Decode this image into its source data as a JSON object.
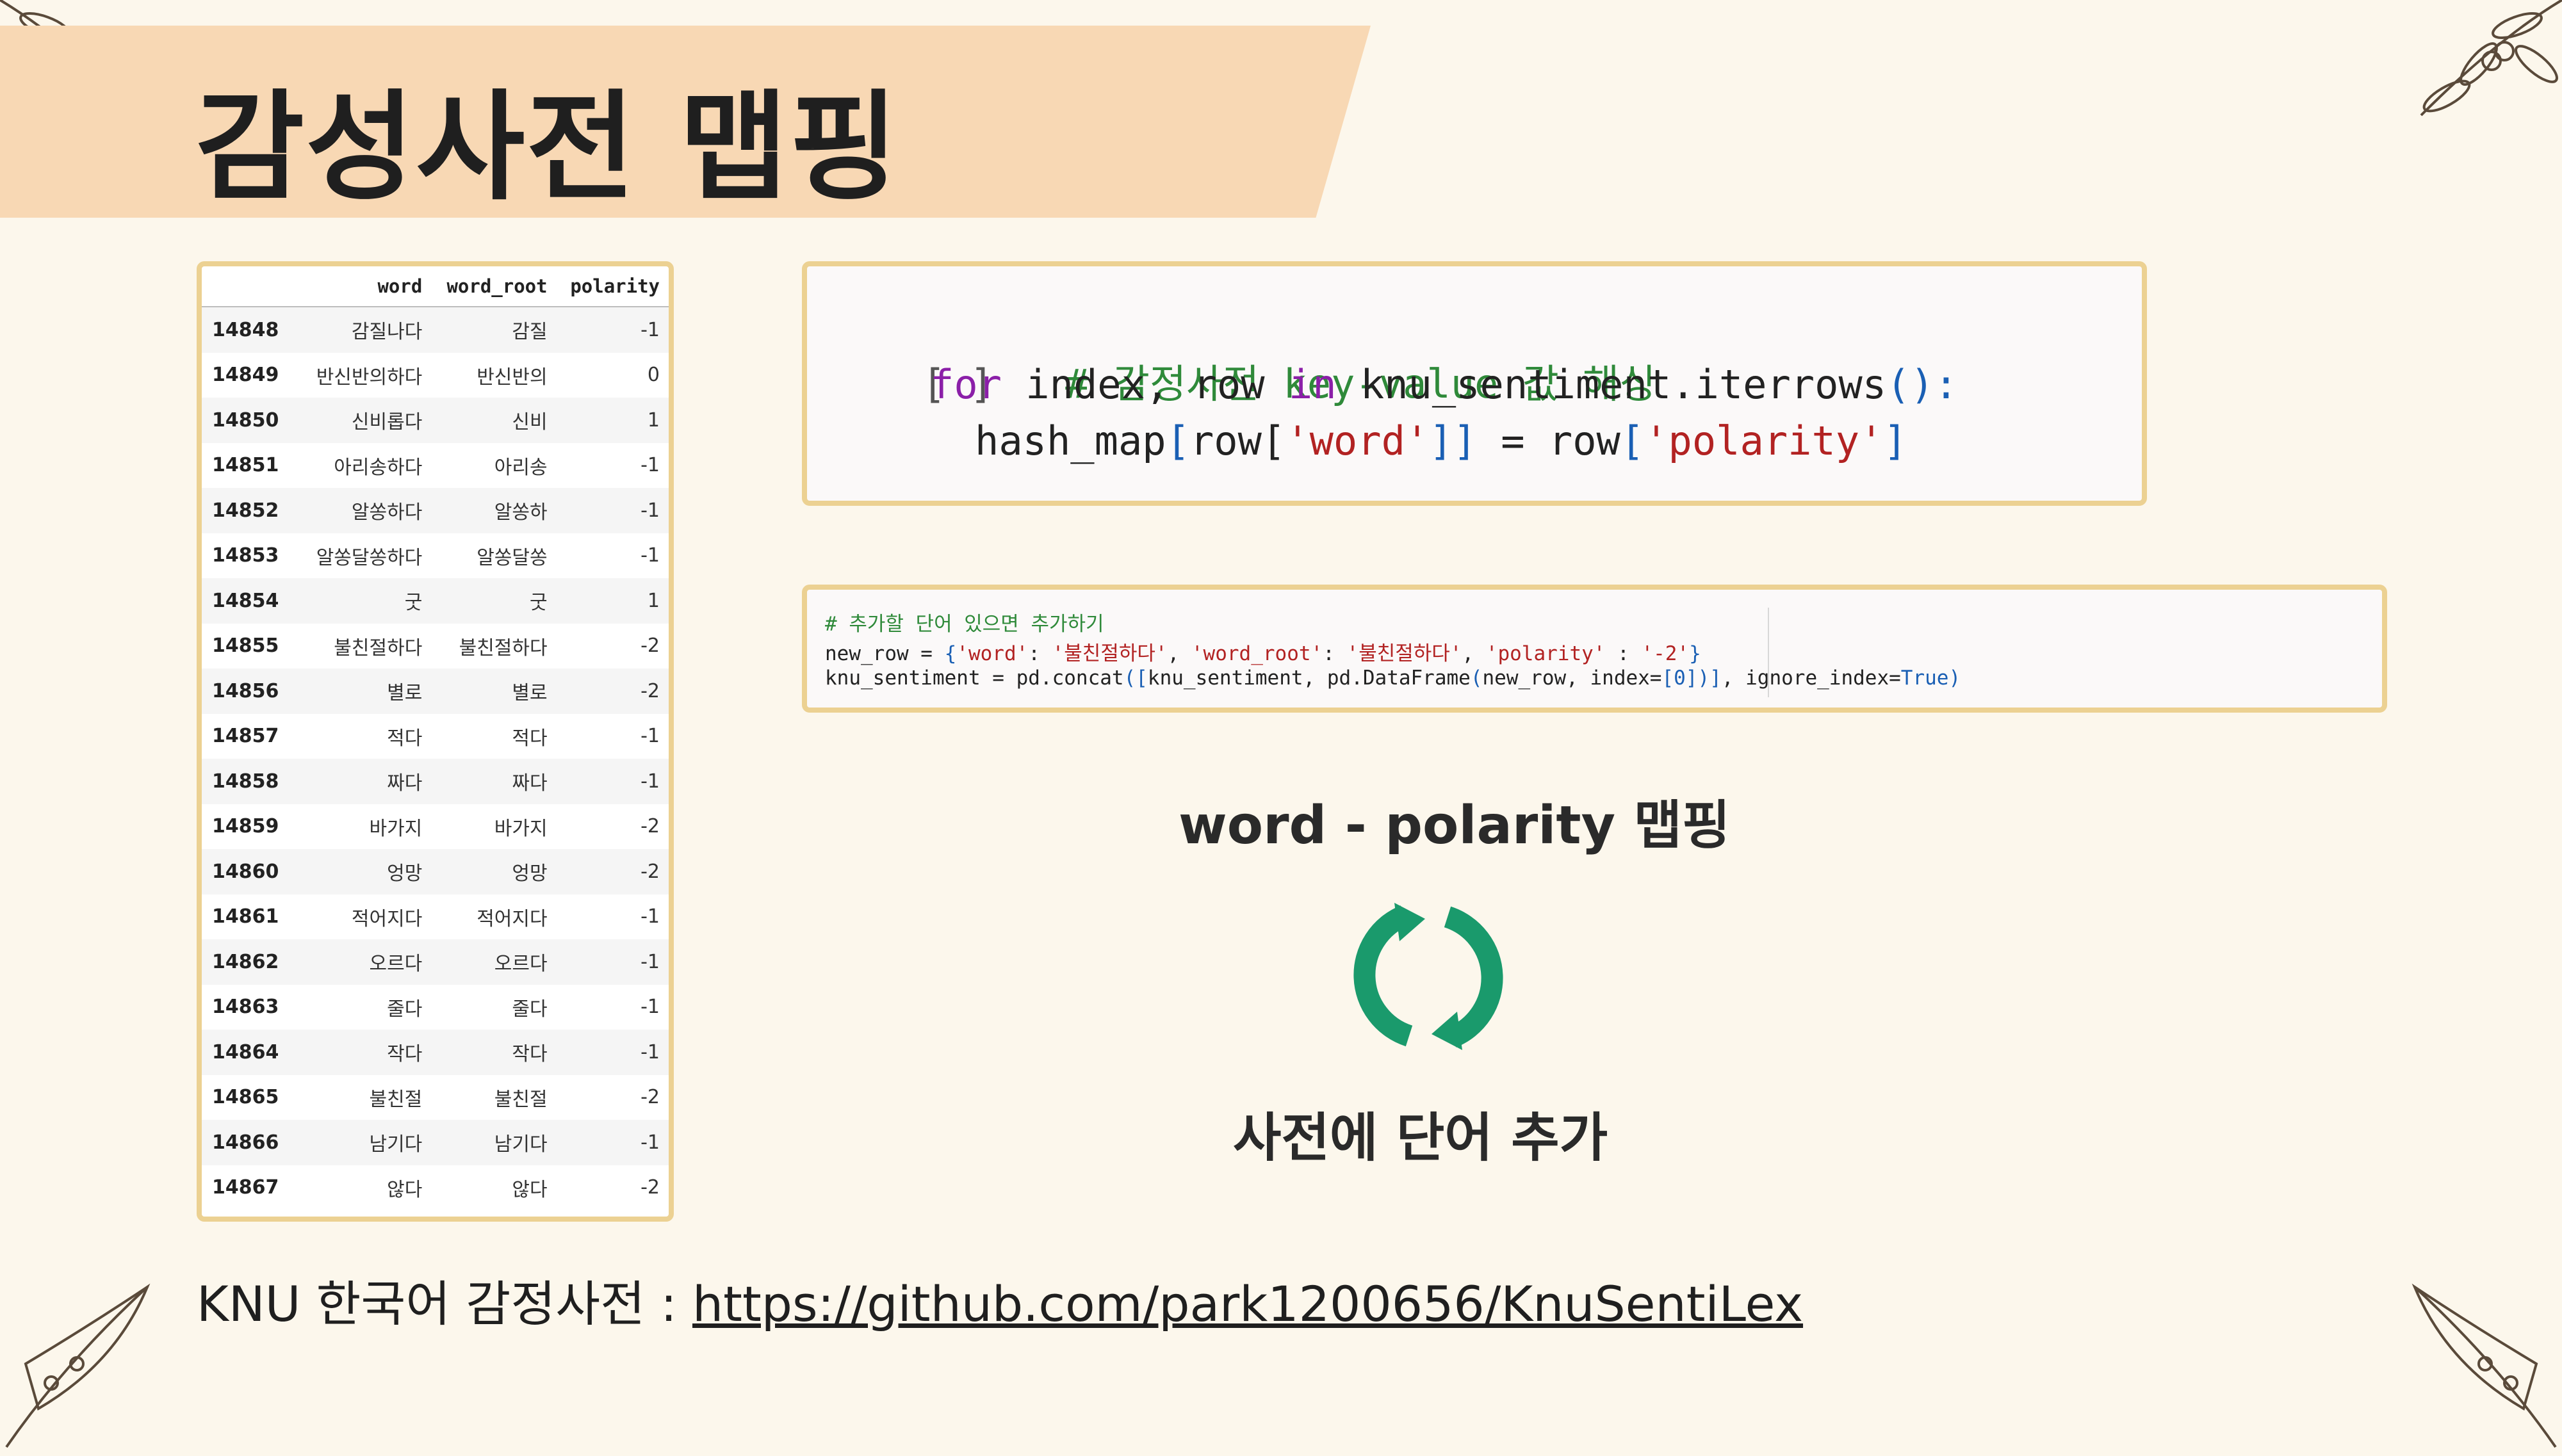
{
  "slide": {
    "title": "감성사전 맵핑"
  },
  "table": {
    "columns": [
      "",
      "word",
      "word_root",
      "polarity"
    ],
    "rows": [
      [
        "14848",
        "감질나다",
        "감질",
        "-1"
      ],
      [
        "14849",
        "반신반의하다",
        "반신반의",
        "0"
      ],
      [
        "14850",
        "신비롭다",
        "신비",
        "1"
      ],
      [
        "14851",
        "아리송하다",
        "아리송",
        "-1"
      ],
      [
        "14852",
        "알쏭하다",
        "알쏭하",
        "-1"
      ],
      [
        "14853",
        "알쏭달쏭하다",
        "알쏭달쏭",
        "-1"
      ],
      [
        "14854",
        "굿",
        "굿",
        "1"
      ],
      [
        "14855",
        "불친절하다",
        "불친절하다",
        "-2"
      ],
      [
        "14856",
        "별로",
        "별로",
        "-2"
      ],
      [
        "14857",
        "적다",
        "적다",
        "-1"
      ],
      [
        "14858",
        "짜다",
        "짜다",
        "-1"
      ],
      [
        "14859",
        "바가지",
        "바가지",
        "-2"
      ],
      [
        "14860",
        "엉망",
        "엉망",
        "-2"
      ],
      [
        "14861",
        "적어지다",
        "적어지다",
        "-1"
      ],
      [
        "14862",
        "오르다",
        "오르다",
        "-1"
      ],
      [
        "14863",
        "줄다",
        "줄다",
        "-1"
      ],
      [
        "14864",
        "작다",
        "작다",
        "-1"
      ],
      [
        "14865",
        "불친절",
        "불친절",
        "-2"
      ],
      [
        "14866",
        "남기다",
        "남기다",
        "-1"
      ],
      [
        "14867",
        "않다",
        "않다",
        "-2"
      ]
    ]
  },
  "code1": {
    "run_marker": "[ ]",
    "comment": "# 감정사전 key-value 값 해싱",
    "kw_for": "for",
    "loop_var": " index, row ",
    "kw_in": "in",
    "loop_iter": " knu_sentiment.iterrows",
    "paren": "():",
    "assign_lhs": "hash_map",
    "brk_open": "[",
    "row_open": "row[",
    "str_word": "'word'",
    "brk_close": "]]",
    "equals": " = row",
    "str_polarity": "'polarity'",
    "brk_end": "]"
  },
  "code2": {
    "comment": "# 추가할 단어 있으면 추가하기",
    "line2_a": "new_row = ",
    "line2_brace_open": "{",
    "line2_k1": "'word'",
    "line2_colon": ": ",
    "line2_v1": "'불친절하다'",
    "line2_sep": ", ",
    "line2_k2": "'word_root'",
    "line2_colon2": ": ",
    "line2_v2": "'불친절하다'",
    "line2_sep2": ", ",
    "line2_k3": "'polarity'",
    "line2_colon3": " : ",
    "line2_v3": "'-2'",
    "line2_brace_close": "}",
    "line3_a": "knu_sentiment = pd.concat",
    "line3_b": "([",
    "line3_c": "knu_sentiment, pd.DataFrame",
    "line3_d": "(",
    "line3_e": "new_row, index=",
    "line3_f": "[0]",
    "line3_g": ")]",
    "line3_h": ", ignore_index=",
    "line3_i": "True",
    "line3_j": ")"
  },
  "captions": {
    "mapping": "word - polarity 맵핑",
    "add": "사전에  단어 추가"
  },
  "footer": {
    "label": "KNU 한국어 감정사전 : ",
    "link": "https://github.com/park1200656/KnuSentiLex"
  },
  "colors": {
    "accent": "#1a9a6c",
    "band": "#f8d8b4",
    "border": "#ecd192"
  },
  "icons": {
    "cycle": "refresh-cycle-icon",
    "decor": "leaf-branch-icon"
  }
}
